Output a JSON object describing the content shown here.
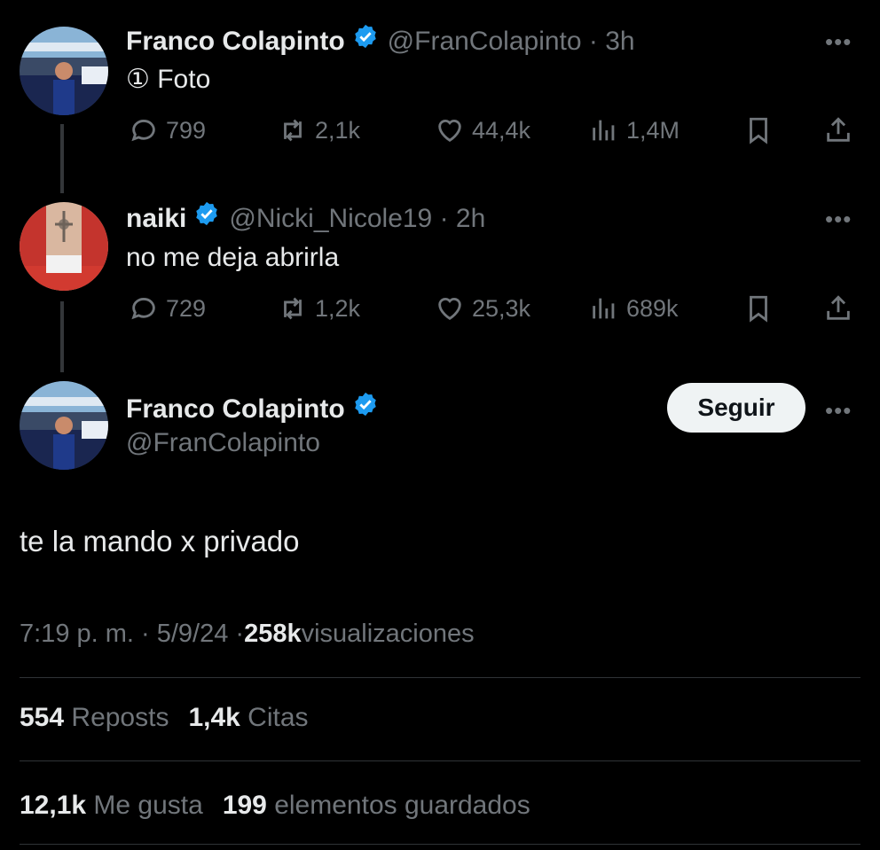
{
  "tweet1": {
    "name": "Franco Colapinto",
    "handle_time": "@FranColapinto · 3h",
    "text": "① Foto",
    "replies": "799",
    "reposts": "2,1k",
    "likes": "44,4k",
    "views": "1,4M"
  },
  "tweet2": {
    "name": "naiki",
    "handle_time": "@Nicki_Nicole19 · 2h",
    "text": "no me deja abrirla",
    "replies": "729",
    "reposts": "1,2k",
    "likes": "25,3k",
    "views": "689k"
  },
  "main": {
    "name": "Franco Colapinto",
    "handle": "@FranColapinto",
    "follow_label": "Seguir",
    "text": "te la mando x privado",
    "time": "7:19 p. m. · 5/9/24 · ",
    "views_count": "258k",
    "views_label": " visualizaciones",
    "reposts_count": "554",
    "reposts_label": " Reposts",
    "quotes_count": "1,4k",
    "quotes_label": " Citas",
    "likes_count": "12,1k",
    "likes_label": " Me gusta",
    "bookmarks_count": "199",
    "bookmarks_label": " elementos guardados"
  },
  "colors": {
    "background": "#000000",
    "verified": "#1d9bf0",
    "muted": "#71767b",
    "text": "#e7e9ea"
  }
}
